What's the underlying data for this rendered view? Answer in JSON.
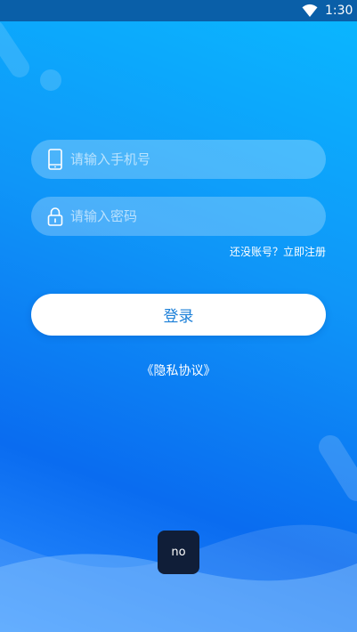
{
  "status_bar": {
    "time": "1:30",
    "wifi_icon": "wifi-icon"
  },
  "login_form": {
    "phone": {
      "icon": "phone-icon",
      "value": "",
      "placeholder": "请输入手机号"
    },
    "password": {
      "icon": "lock-icon",
      "value": "",
      "placeholder": "请输入密码"
    },
    "register_link": "还没账号？立即注册",
    "login_button": "登录",
    "privacy_link": "《隐私协议》"
  },
  "toast": {
    "text": "no"
  },
  "colors": {
    "background_top": "#0ab8ff",
    "background_bottom": "#0a6cf0",
    "button_text": "#1b7fd8",
    "status_bar": "#0a5fa8",
    "toast_bg": "#101e38"
  }
}
